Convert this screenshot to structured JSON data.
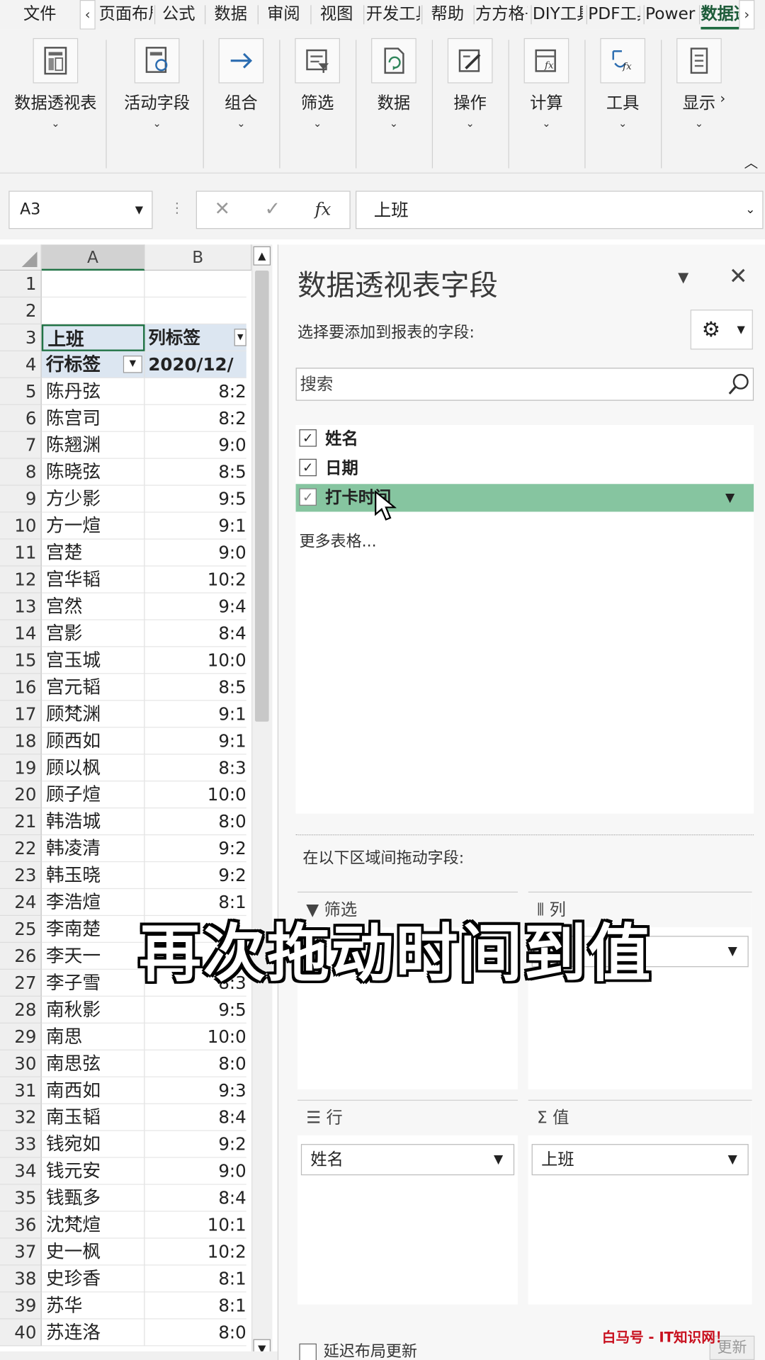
{
  "ribbon_tabs": [
    {
      "label": "文件"
    },
    {
      "label": "页面布局"
    },
    {
      "label": "公式"
    },
    {
      "label": "数据"
    },
    {
      "label": "审阅"
    },
    {
      "label": "视图"
    },
    {
      "label": "开发工具"
    },
    {
      "label": "帮助"
    },
    {
      "label": "方方格子"
    },
    {
      "label": "DIY工具箱"
    },
    {
      "label": "PDF工具集"
    },
    {
      "label": "Power Pivot"
    },
    {
      "label": "数据透视表分析"
    }
  ],
  "ribbon_groups": [
    {
      "label": "数据透视表",
      "icon": "pivottable-icon"
    },
    {
      "label": "活动字段",
      "icon": "active-field-icon"
    },
    {
      "label": "组合",
      "icon": "group-arrow-icon"
    },
    {
      "label": "筛选",
      "icon": "filter-icon"
    },
    {
      "label": "数据",
      "icon": "refresh-data-icon"
    },
    {
      "label": "操作",
      "icon": "actions-icon"
    },
    {
      "label": "计算",
      "icon": "calculation-icon"
    },
    {
      "label": "工具",
      "icon": "tools-icon"
    },
    {
      "label": "显示",
      "icon": "show-icon"
    }
  ],
  "formula_bar": {
    "name_box": "A3",
    "fx": "fx",
    "content": "上班"
  },
  "sheet": {
    "columns": [
      "A",
      "B"
    ],
    "rows": [
      {
        "n": "1",
        "a": "",
        "b": ""
      },
      {
        "n": "2",
        "a": "",
        "b": ""
      },
      {
        "n": "3",
        "a": "上班",
        "b": "列标签"
      },
      {
        "n": "4",
        "a": "行标签",
        "b": "2020/12/"
      },
      {
        "n": "5",
        "a": "陈丹弦",
        "b": "8:2"
      },
      {
        "n": "6",
        "a": "陈宫司",
        "b": "8:2"
      },
      {
        "n": "7",
        "a": "陈翘渊",
        "b": "9:0"
      },
      {
        "n": "8",
        "a": "陈晓弦",
        "b": "8:5"
      },
      {
        "n": "9",
        "a": "方少影",
        "b": "9:5"
      },
      {
        "n": "10",
        "a": "方一煊",
        "b": "9:1"
      },
      {
        "n": "11",
        "a": "宫楚",
        "b": "9:0"
      },
      {
        "n": "12",
        "a": "宫华韬",
        "b": "10:2"
      },
      {
        "n": "13",
        "a": "宫然",
        "b": "9:4"
      },
      {
        "n": "14",
        "a": "宫影",
        "b": "8:4"
      },
      {
        "n": "15",
        "a": "宫玉城",
        "b": "10:0"
      },
      {
        "n": "16",
        "a": "宫元韬",
        "b": "8:5"
      },
      {
        "n": "17",
        "a": "顾梵渊",
        "b": "9:1"
      },
      {
        "n": "18",
        "a": "顾西如",
        "b": "9:1"
      },
      {
        "n": "19",
        "a": "顾以枫",
        "b": "8:3"
      },
      {
        "n": "20",
        "a": "顾子煊",
        "b": "10:0"
      },
      {
        "n": "21",
        "a": "韩浩城",
        "b": "8:0"
      },
      {
        "n": "22",
        "a": "韩凌清",
        "b": "9:2"
      },
      {
        "n": "23",
        "a": "韩玉晓",
        "b": "9:2"
      },
      {
        "n": "24",
        "a": "李浩煊",
        "b": "8:1"
      },
      {
        "n": "25",
        "a": "李南楚",
        "b": ""
      },
      {
        "n": "26",
        "a": "李天一",
        "b": ""
      },
      {
        "n": "27",
        "a": "李子雪",
        "b": "8:3"
      },
      {
        "n": "28",
        "a": "南秋影",
        "b": "9:5"
      },
      {
        "n": "29",
        "a": "南思",
        "b": "10:0"
      },
      {
        "n": "30",
        "a": "南思弦",
        "b": "8:0"
      },
      {
        "n": "31",
        "a": "南西如",
        "b": "9:3"
      },
      {
        "n": "32",
        "a": "南玉韬",
        "b": "8:4"
      },
      {
        "n": "33",
        "a": "钱宛如",
        "b": "9:2"
      },
      {
        "n": "34",
        "a": "钱元安",
        "b": "9:0"
      },
      {
        "n": "35",
        "a": "钱甄多",
        "b": "8:4"
      },
      {
        "n": "36",
        "a": "沈梵煊",
        "b": "10:1"
      },
      {
        "n": "37",
        "a": "史一枫",
        "b": "10:2"
      },
      {
        "n": "38",
        "a": "史珍香",
        "b": "8:1"
      },
      {
        "n": "39",
        "a": "苏华",
        "b": "8:1"
      },
      {
        "n": "40",
        "a": "苏连洛",
        "b": "8:0"
      }
    ]
  },
  "pivot_pane": {
    "title": "数据透视表字段",
    "subtitle": "选择要添加到报表的字段:",
    "search_placeholder": "搜索",
    "fields": [
      {
        "label": "姓名",
        "checked": true
      },
      {
        "label": "日期",
        "checked": true
      },
      {
        "label": "打卡时间",
        "checked": true
      }
    ],
    "more_tables": "更多表格...",
    "drag_label": "在以下区域间拖动字段:",
    "areas": {
      "filter": {
        "label": "筛选",
        "item": ""
      },
      "columns": {
        "label": "列",
        "item": ""
      },
      "rows": {
        "label": "行",
        "item": "姓名"
      },
      "values": {
        "label": "值",
        "item": "上班"
      }
    },
    "defer_label": "延迟布局更新",
    "update_label": "更新"
  },
  "caption": "再次拖动时间到值",
  "watermark": "白马号 - IT知识网！"
}
